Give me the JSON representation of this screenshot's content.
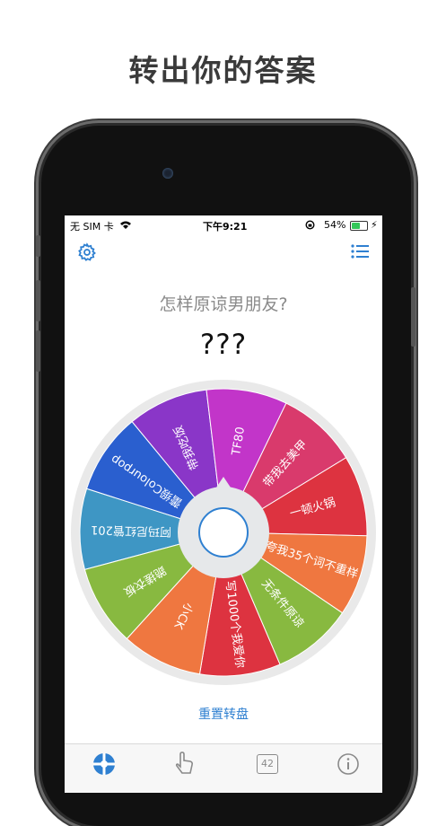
{
  "headline": "转出你的答案",
  "status_bar": {
    "carrier": "无 SIM 卡",
    "time": "下午9:21",
    "battery_text": "54%",
    "battery_level": 0.54
  },
  "top_bar": {
    "left_icon": "gear-icon",
    "right_icon": "list-icon"
  },
  "question": "怎样原谅男朋友?",
  "result": "???",
  "wheel": {
    "segments": [
      {
        "label": "阿玛尼红管201",
        "color": "#3e96c4"
      },
      {
        "label": "蕾缎Colourpop",
        "color": "#2a5fcf"
      },
      {
        "label": "带我吃饭",
        "color": "#8a36c8"
      },
      {
        "label": "TF80",
        "color": "#c235c9"
      },
      {
        "label": "带我去美甲",
        "color": "#d93a6c"
      },
      {
        "label": "一顿火锅",
        "color": "#dd3340"
      },
      {
        "label": "夸我35个词不重样",
        "color": "#ef7740"
      },
      {
        "label": "无条件原谅",
        "color": "#88b940"
      },
      {
        "label": "写1000个我爱你",
        "color": "#dd3340"
      },
      {
        "label": "小CK",
        "color": "#ef7740"
      },
      {
        "label": "跪搓衣板",
        "color": "#88b940"
      }
    ]
  },
  "reset_label": "重置转盘",
  "tabs": [
    {
      "icon": "wheel-icon",
      "active": true
    },
    {
      "icon": "tap-icon"
    },
    {
      "icon": "number-icon",
      "label": "42"
    },
    {
      "icon": "info-icon"
    }
  ]
}
